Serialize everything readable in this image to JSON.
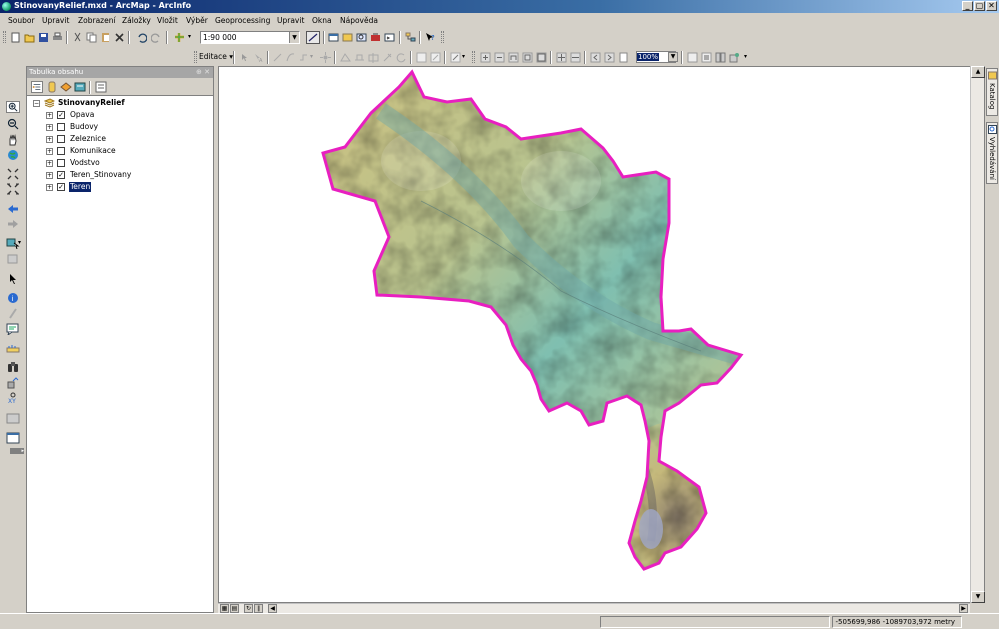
{
  "window": {
    "title": "StinovanyRelief.mxd - ArcMap - ArcInfo",
    "buttons": {
      "minimize": "_",
      "restore": "▢",
      "close": "✕"
    }
  },
  "menu": {
    "items": [
      "Soubor",
      "Upravit",
      "Zobrazení",
      "Záložky",
      "Vložit",
      "Výběr",
      "Geoprocessing",
      "Upravit",
      "Okna",
      "Nápověda"
    ]
  },
  "toolbar": {
    "scale_value": "1:90 000",
    "editor_label": "Editace ▾",
    "zoom_percent": "100%"
  },
  "toc": {
    "title": "Tabulka obsahu",
    "group": {
      "name": "StinovanyRelief",
      "expanded": true
    },
    "layers": [
      {
        "name": "Opava",
        "checked": true
      },
      {
        "name": "Budovy",
        "checked": false
      },
      {
        "name": "Zeleznice",
        "checked": false
      },
      {
        "name": "Komunikace",
        "checked": false
      },
      {
        "name": "Vodstvo",
        "checked": false
      },
      {
        "name": "Teren_Stinovany",
        "checked": true
      },
      {
        "name": "Teren",
        "checked": true,
        "selected": true
      }
    ]
  },
  "right_panels": {
    "katalog": "Katalog",
    "vyhledavani": "Vyhledávání"
  },
  "status": {
    "coordinates": "-505699,986  -1089703,972 metry"
  },
  "map": {
    "boundary_color": "#e81fc0",
    "relief_low_color": "#7fbfb0",
    "relief_high_color": "#c8b878"
  }
}
